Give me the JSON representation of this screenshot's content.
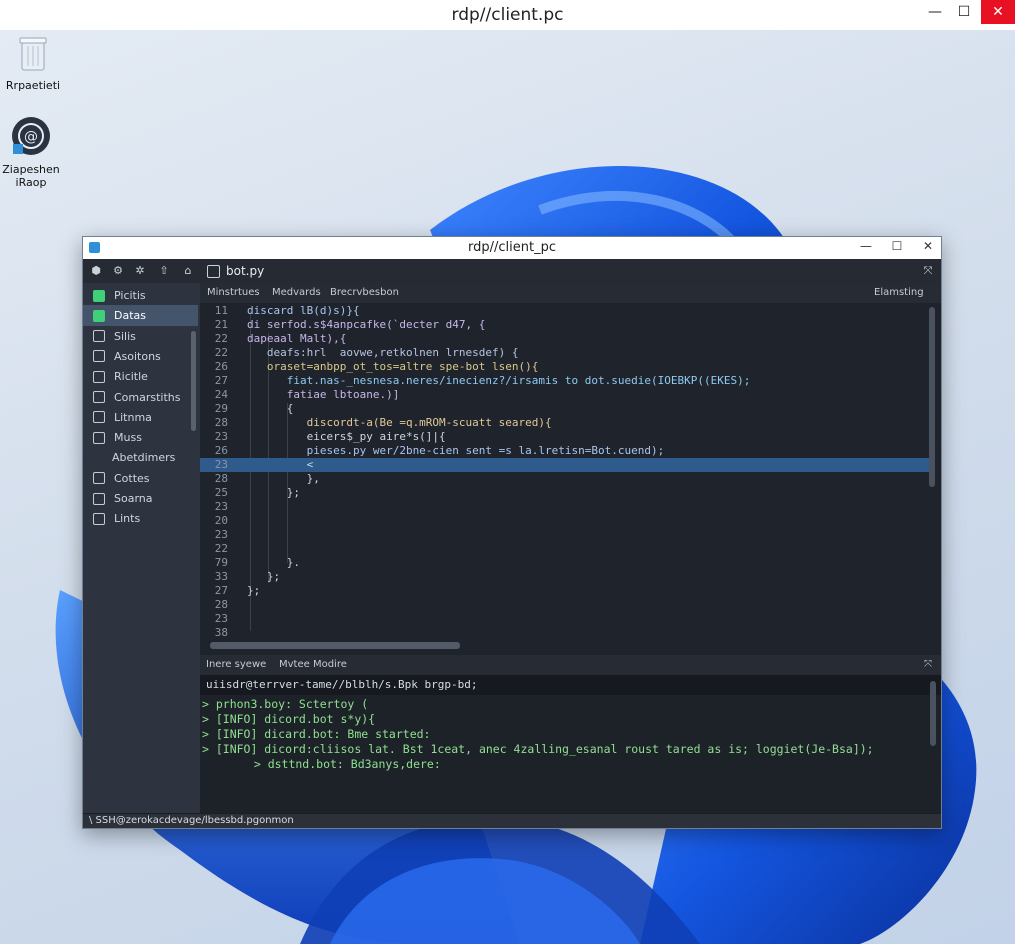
{
  "rdp_window": {
    "title": "rdp//client.pc",
    "min_glyph": "—",
    "max_glyph": "☐",
    "close_glyph": "✕"
  },
  "desktop_icons": [
    {
      "name": "recycle-bin",
      "label": "Rrpaetieti",
      "icon": "recycle-bin-icon"
    },
    {
      "name": "discord-app",
      "label": "Ziapeshen iRaop",
      "icon": "app-icon"
    }
  ],
  "inner_window": {
    "title": "rdp//client_pc",
    "min_glyph": "—",
    "max_glyph": "☐",
    "close_glyph": "✕"
  },
  "toolbar": {
    "active_file": "bot.py",
    "close_glyph": "⤧"
  },
  "sidebar": {
    "items": [
      {
        "label": "Picitis",
        "icon": "folder-icon",
        "active": false
      },
      {
        "label": "Datas",
        "icon": "file-icon",
        "active": true
      },
      {
        "label": "Silis",
        "icon": "list-icon",
        "active": false
      },
      {
        "label": "Asoitons",
        "icon": "person-icon",
        "active": false
      },
      {
        "label": "Ricitle",
        "icon": "arrows-icon",
        "active": false
      },
      {
        "label": "Comarstiths",
        "icon": "gear-icon",
        "active": false
      },
      {
        "label": "Litnma",
        "icon": "plug-icon",
        "active": false
      },
      {
        "label": "Muss",
        "icon": "grid-icon",
        "active": false
      },
      {
        "label": "Abetdimers",
        "icon": "",
        "active": false
      },
      {
        "label": "Cottes",
        "icon": "cloud-icon",
        "active": false
      },
      {
        "label": "Soarna",
        "icon": "shield-icon",
        "active": false
      },
      {
        "label": "Lints",
        "icon": "monitor-icon",
        "active": false
      }
    ]
  },
  "editor": {
    "header_items": [
      "Minstrtues",
      "Medvards",
      "Brecrvbesbon"
    ],
    "header_right": "Elamsting",
    "lines": [
      {
        "ln": "11",
        "code": "discard lB(d)s)}{",
        "color": "#a9c4ee",
        "hl": false
      },
      {
        "ln": "21",
        "code": "di serfod.s$4anpcafke(`decter d47, {",
        "color": "#c8b6e8",
        "hl": false
      },
      {
        "ln": "22",
        "code": "dapeaal Malt),{",
        "color": "#c8b6e8",
        "hl": false
      },
      {
        "ln": "22",
        "code": "   deafs:hrl  aovwe,retkolnen lrnesdef) {",
        "color": "#b6c2e0",
        "hl": false
      },
      {
        "ln": "26",
        "code": "   oraset=anbpp_ot_tos=altre spe-bot lsen(){",
        "color": "#d8c88a",
        "hl": false
      },
      {
        "ln": "27",
        "code": "      fiat.nas-_nesnesa.neres/inecienz?/irsamis to dot.suedie(IOEBKP((EKES);",
        "color": "#8ec9f0",
        "hl": false
      },
      {
        "ln": "24",
        "code": "      fatiae lbtoane.)]",
        "color": "#c8b6e8",
        "hl": false
      },
      {
        "ln": "29",
        "code": "      {",
        "color": "#cfd6e0",
        "hl": false
      },
      {
        "ln": "28",
        "code": "         discordt-a(Be =q.mROM-scuatt seared){",
        "color": "#e0c89a",
        "hl": false
      },
      {
        "ln": "23",
        "code": "         eicers$_py aire*s(]|{",
        "color": "#cfd6e0",
        "hl": false
      },
      {
        "ln": "26",
        "code": "         pieses.py wer/2bne-cien sent =s la.lretisn=Bot.cuend);",
        "color": "#a9c4ee",
        "hl": false
      },
      {
        "ln": "23",
        "code": "         <",
        "color": "#cfd6e0",
        "hl": true
      },
      {
        "ln": "28",
        "code": "         },",
        "color": "#cfd6e0",
        "hl": false
      },
      {
        "ln": "25",
        "code": "      };",
        "color": "#cfd6e0",
        "hl": false
      },
      {
        "ln": "23",
        "code": "",
        "color": "#cfd6e0",
        "hl": false
      },
      {
        "ln": "20",
        "code": "",
        "color": "#cfd6e0",
        "hl": false
      },
      {
        "ln": "23",
        "code": "",
        "color": "#cfd6e0",
        "hl": false
      },
      {
        "ln": "22",
        "code": "",
        "color": "#cfd6e0",
        "hl": false
      },
      {
        "ln": "79",
        "code": "      }.",
        "color": "#cfd6e0",
        "hl": false
      },
      {
        "ln": "33",
        "code": "   };",
        "color": "#cfd6e0",
        "hl": false
      },
      {
        "ln": "27",
        "code": "};",
        "color": "#cfd6e0",
        "hl": false
      },
      {
        "ln": "28",
        "code": "",
        "color": "#cfd6e0",
        "hl": false
      },
      {
        "ln": "23",
        "code": "",
        "color": "#cfd6e0",
        "hl": false
      },
      {
        "ln": "38",
        "code": "",
        "color": "#cfd6e0",
        "hl": false
      }
    ]
  },
  "terminal": {
    "header_items": [
      "Inere syewe",
      "Mvtee Modire"
    ],
    "prompt": "uiisdr@terrver-tame//blblh/s.Bpk brgp-bd;",
    "lines": [
      {
        "text": "> prhon3.boy: Sctertoy (",
        "indent": false
      },
      {
        "text": "> [INFO] dicord.bot s*y){",
        "indent": false
      },
      {
        "text": "> [INFO] dicard.bot: Bme started:",
        "indent": false
      },
      {
        "text": "> [INFO] dicord:cliisos lat. Bst 1ceat, anec 4zalling_esanal roust tared as is; loggiet(Je-Bsa]);",
        "indent": false
      },
      {
        "text": "  > dsttnd.bot: Bd3anys,dere:",
        "indent": true
      }
    ]
  },
  "status": {
    "text": "\\ SSH@zerokacdevage/lbessbd.pgonmon"
  },
  "colors": {
    "accent_blue": "#2f5a8c",
    "terminal_green": "#8fe08f",
    "close_red": "#e81123"
  }
}
